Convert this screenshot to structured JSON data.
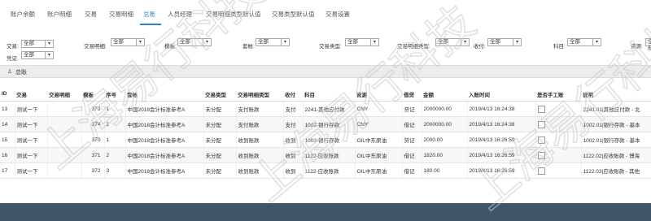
{
  "tabs": [
    {
      "label": "账户余额"
    },
    {
      "label": "账户明细"
    },
    {
      "label": "交易"
    },
    {
      "label": "交易明细"
    },
    {
      "label": "总账"
    },
    {
      "label": "人员经理"
    },
    {
      "label": "交易明细类型默认值"
    },
    {
      "label": "交易类型默认值"
    },
    {
      "label": "交易设置"
    }
  ],
  "filters": {
    "交易": {
      "label": "交易:",
      "value": "全部"
    },
    "交易明细": {
      "label": "交易明细:",
      "value": "全部"
    },
    "模板": {
      "label": "模板:",
      "value": "全部"
    },
    "套帐": {
      "label": "套帐:",
      "value": "全部"
    },
    "交易类型": {
      "label": "交易类型:",
      "value": "全部"
    },
    "交易明细类型": {
      "label": "交易明细类型:",
      "value": "全部"
    },
    "收付": {
      "label": "收付:",
      "value": "全部"
    },
    "科目": {
      "label": "科目:",
      "value": "全部"
    },
    "资源": {
      "label": "资源:",
      "value": "全部"
    },
    "凭证": {
      "label": "凭证:",
      "value": "全部"
    }
  },
  "panel": {
    "title": "总账",
    "icon": "user-icon"
  },
  "table": {
    "headers": [
      "ID",
      "交易",
      "交易明细",
      "模板",
      "序号",
      "套帐",
      "交易类型",
      "交易明细类型",
      "收付",
      "科目",
      "资源",
      "借贷",
      "金额",
      "入账时间",
      "是否手工账",
      "说明"
    ],
    "rows": [
      [
        "13",
        "测试一下",
        "",
        "373",
        "1",
        "中国2018会计标准参考A",
        "未分配",
        "支付账款",
        "支付",
        "2241-其他应付款",
        "CNY",
        "贷记",
        "2000000.00",
        "2019/4/13 16:24:38",
        "",
        "2241.01|其他应付款 - 北"
      ],
      [
        "14",
        "测试一下",
        "",
        "374",
        "2",
        "中国2018会计标准参考A",
        "未分配",
        "支付账款",
        "支付",
        "1002-银行存款",
        "CNY",
        "借记",
        "2000000.00",
        "2019/4/13 16:24:38",
        "",
        "1002.01|银行存款 - 基本"
      ],
      [
        "15",
        "测试一下",
        "",
        "370",
        "1",
        "中国2018会计标准参考A",
        "未分配",
        "收到账款",
        "收到",
        "1002-银行存款",
        "OIL中东原油",
        "贷记",
        "2000.00",
        "2019/4/13 16:26:59",
        "",
        "1002.01|银行存款 - 基本"
      ],
      [
        "16",
        "测试一下",
        "",
        "371",
        "2",
        "中国2018会计标准参考A",
        "未分配",
        "收到账款",
        "收到",
        "1122-应收账款",
        "OIL中东原油",
        "借记",
        "1820.00",
        "2019/4/13 16:26:59",
        "",
        "1122.02|应收账款 - 博海"
      ],
      [
        "17",
        "测试一下",
        "",
        "372",
        "3",
        "中国2018会计标准参考A",
        "未分配",
        "收到账款",
        "收到",
        "1122-应收账款",
        "OIL中东原油",
        "借记",
        "180.00",
        "2019/4/13 16:26:59",
        "",
        "1122.03|应收账款 - 其他"
      ]
    ]
  },
  "watermark": {
    "text": "上海易行科技"
  },
  "colors": {
    "accent": "#2e86c1",
    "footer": "#3f5568",
    "panel": "#ececec"
  }
}
